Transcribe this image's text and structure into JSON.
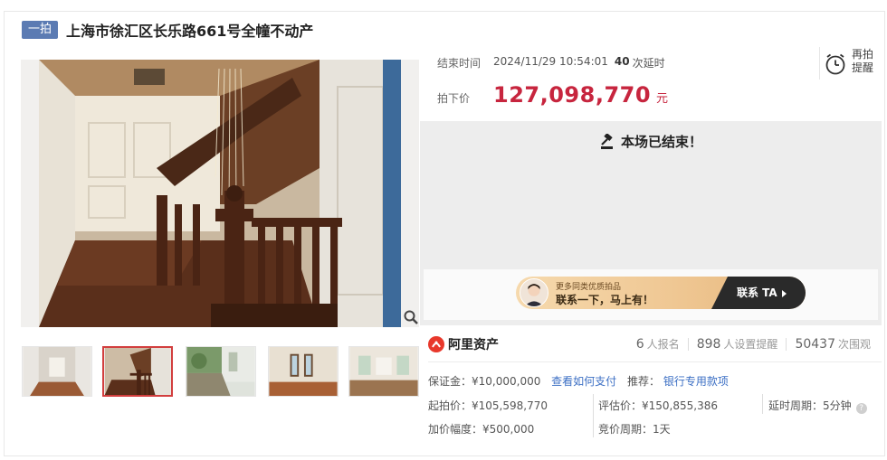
{
  "title_tag": "一拍",
  "title": "上海市徐汇区长乐路661号全幢不动产",
  "auction": {
    "end_label": "结束时间",
    "end_time": "2024/11/29 10:54:01",
    "delay_count": "40",
    "delay_unit": "次延时",
    "price_label": "拍下价",
    "price": "127,098,770",
    "price_unit": "元",
    "remind_label": "再拍提醒",
    "ended_text": "本场已结束！"
  },
  "promo": {
    "line1": "更多同类优质拍品",
    "line2": "联系一下，马上有！",
    "button": "联系 TA"
  },
  "seller": {
    "name": "阿里资产"
  },
  "stats": [
    {
      "num": "6",
      "label": "人报名"
    },
    {
      "num": "898",
      "label": "人设置提醒"
    },
    {
      "num": "50437",
      "label": "次围观"
    }
  ],
  "deposit": {
    "label": "保证金：¥10,000,000",
    "link": "查看如何支付",
    "recommend_label": "推荐：",
    "recommend_link": "银行专用款项"
  },
  "details": {
    "start_price": "起拍价：¥105,598,770",
    "eval_price": "评估价：¥150,855,386",
    "delay_period": "延时周期：5分钟",
    "increment": "加价幅度：¥500,000",
    "bid_period": "竞价周期：1天"
  },
  "colors": {
    "price": "#c7253e",
    "link": "#3c6fc4",
    "tag": "#5b7bb3",
    "thumb_active": "#d23e3e"
  }
}
